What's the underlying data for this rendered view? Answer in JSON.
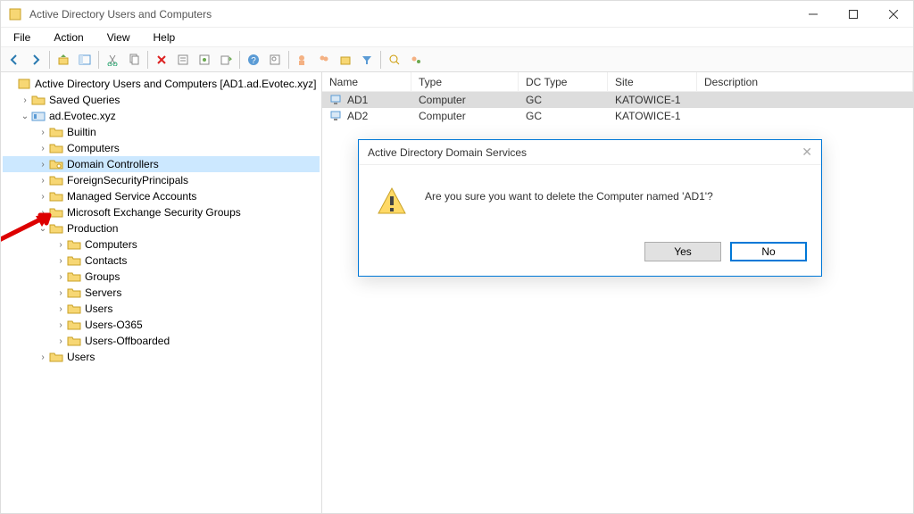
{
  "window": {
    "title": "Active Directory Users and Computers"
  },
  "menu": {
    "file": "File",
    "action": "Action",
    "view": "View",
    "help": "Help"
  },
  "tree": {
    "root": "Active Directory Users and Computers [AD1.ad.Evotec.xyz]",
    "saved_queries": "Saved Queries",
    "domain": "ad.Evotec.xyz",
    "nodes": {
      "builtin": "Builtin",
      "computers": "Computers",
      "domain_controllers": "Domain Controllers",
      "fsp": "ForeignSecurityPrincipals",
      "msa": "Managed Service Accounts",
      "exchange": "Microsoft Exchange Security Groups",
      "production": "Production",
      "prod_children": {
        "computers": "Computers",
        "contacts": "Contacts",
        "groups": "Groups",
        "servers": "Servers",
        "users": "Users",
        "users_o365": "Users-O365",
        "users_off": "Users-Offboarded"
      },
      "users": "Users"
    }
  },
  "columns": {
    "name": "Name",
    "type": "Type",
    "dctype": "DC Type",
    "site": "Site",
    "desc": "Description"
  },
  "rows": [
    {
      "name": "AD1",
      "type": "Computer",
      "dctype": "GC",
      "site": "KATOWICE-1"
    },
    {
      "name": "AD2",
      "type": "Computer",
      "dctype": "GC",
      "site": "KATOWICE-1"
    }
  ],
  "dialog": {
    "title": "Active Directory Domain Services",
    "message": "Are you sure you want to delete the Computer named 'AD1'?",
    "yes": "Yes",
    "no": "No"
  }
}
